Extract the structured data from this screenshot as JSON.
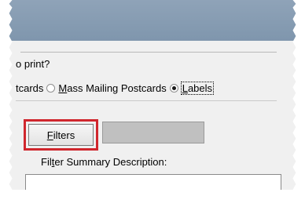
{
  "dialog": {
    "question_text": "o print?",
    "radio_options": [
      {
        "label_prefix": "",
        "label_accel": "",
        "label_rest": "tcards",
        "checked": false
      },
      {
        "label_prefix": "",
        "label_accel": "M",
        "label_rest": "ass Mailing Postcards",
        "checked": false
      },
      {
        "label_prefix": "",
        "label_accel": "L",
        "label_rest": "abels",
        "checked": true
      }
    ],
    "filters_button": {
      "accel": "F",
      "rest": "ilters"
    },
    "filters_value": "",
    "summary_label": {
      "prefix": "Fil",
      "accel": "t",
      "rest": "er Summary Description:"
    },
    "summary_value": ""
  },
  "colors": {
    "titlebar": "#8fa3b8",
    "highlight_border": "#d0262d",
    "dialog_bg": "#f0f0f0"
  }
}
